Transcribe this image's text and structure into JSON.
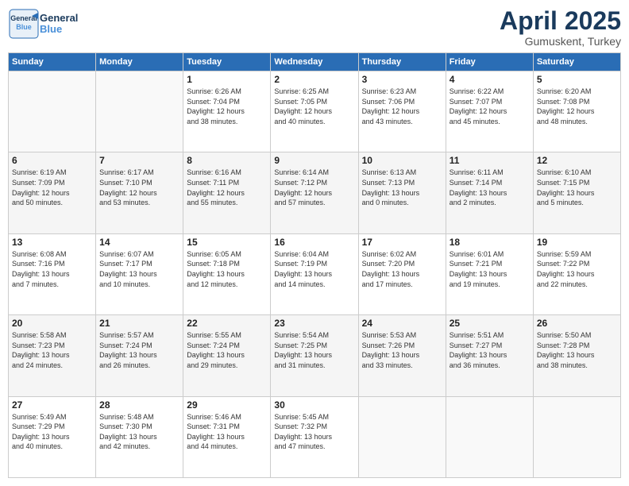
{
  "header": {
    "logo_line1": "General",
    "logo_line2": "Blue",
    "month": "April 2025",
    "location": "Gumuskent, Turkey"
  },
  "days_of_week": [
    "Sunday",
    "Monday",
    "Tuesday",
    "Wednesday",
    "Thursday",
    "Friday",
    "Saturday"
  ],
  "weeks": [
    [
      {
        "day": "",
        "info": ""
      },
      {
        "day": "",
        "info": ""
      },
      {
        "day": "1",
        "info": "Sunrise: 6:26 AM\nSunset: 7:04 PM\nDaylight: 12 hours\nand 38 minutes."
      },
      {
        "day": "2",
        "info": "Sunrise: 6:25 AM\nSunset: 7:05 PM\nDaylight: 12 hours\nand 40 minutes."
      },
      {
        "day": "3",
        "info": "Sunrise: 6:23 AM\nSunset: 7:06 PM\nDaylight: 12 hours\nand 43 minutes."
      },
      {
        "day": "4",
        "info": "Sunrise: 6:22 AM\nSunset: 7:07 PM\nDaylight: 12 hours\nand 45 minutes."
      },
      {
        "day": "5",
        "info": "Sunrise: 6:20 AM\nSunset: 7:08 PM\nDaylight: 12 hours\nand 48 minutes."
      }
    ],
    [
      {
        "day": "6",
        "info": "Sunrise: 6:19 AM\nSunset: 7:09 PM\nDaylight: 12 hours\nand 50 minutes."
      },
      {
        "day": "7",
        "info": "Sunrise: 6:17 AM\nSunset: 7:10 PM\nDaylight: 12 hours\nand 53 minutes."
      },
      {
        "day": "8",
        "info": "Sunrise: 6:16 AM\nSunset: 7:11 PM\nDaylight: 12 hours\nand 55 minutes."
      },
      {
        "day": "9",
        "info": "Sunrise: 6:14 AM\nSunset: 7:12 PM\nDaylight: 12 hours\nand 57 minutes."
      },
      {
        "day": "10",
        "info": "Sunrise: 6:13 AM\nSunset: 7:13 PM\nDaylight: 13 hours\nand 0 minutes."
      },
      {
        "day": "11",
        "info": "Sunrise: 6:11 AM\nSunset: 7:14 PM\nDaylight: 13 hours\nand 2 minutes."
      },
      {
        "day": "12",
        "info": "Sunrise: 6:10 AM\nSunset: 7:15 PM\nDaylight: 13 hours\nand 5 minutes."
      }
    ],
    [
      {
        "day": "13",
        "info": "Sunrise: 6:08 AM\nSunset: 7:16 PM\nDaylight: 13 hours\nand 7 minutes."
      },
      {
        "day": "14",
        "info": "Sunrise: 6:07 AM\nSunset: 7:17 PM\nDaylight: 13 hours\nand 10 minutes."
      },
      {
        "day": "15",
        "info": "Sunrise: 6:05 AM\nSunset: 7:18 PM\nDaylight: 13 hours\nand 12 minutes."
      },
      {
        "day": "16",
        "info": "Sunrise: 6:04 AM\nSunset: 7:19 PM\nDaylight: 13 hours\nand 14 minutes."
      },
      {
        "day": "17",
        "info": "Sunrise: 6:02 AM\nSunset: 7:20 PM\nDaylight: 13 hours\nand 17 minutes."
      },
      {
        "day": "18",
        "info": "Sunrise: 6:01 AM\nSunset: 7:21 PM\nDaylight: 13 hours\nand 19 minutes."
      },
      {
        "day": "19",
        "info": "Sunrise: 5:59 AM\nSunset: 7:22 PM\nDaylight: 13 hours\nand 22 minutes."
      }
    ],
    [
      {
        "day": "20",
        "info": "Sunrise: 5:58 AM\nSunset: 7:23 PM\nDaylight: 13 hours\nand 24 minutes."
      },
      {
        "day": "21",
        "info": "Sunrise: 5:57 AM\nSunset: 7:24 PM\nDaylight: 13 hours\nand 26 minutes."
      },
      {
        "day": "22",
        "info": "Sunrise: 5:55 AM\nSunset: 7:24 PM\nDaylight: 13 hours\nand 29 minutes."
      },
      {
        "day": "23",
        "info": "Sunrise: 5:54 AM\nSunset: 7:25 PM\nDaylight: 13 hours\nand 31 minutes."
      },
      {
        "day": "24",
        "info": "Sunrise: 5:53 AM\nSunset: 7:26 PM\nDaylight: 13 hours\nand 33 minutes."
      },
      {
        "day": "25",
        "info": "Sunrise: 5:51 AM\nSunset: 7:27 PM\nDaylight: 13 hours\nand 36 minutes."
      },
      {
        "day": "26",
        "info": "Sunrise: 5:50 AM\nSunset: 7:28 PM\nDaylight: 13 hours\nand 38 minutes."
      }
    ],
    [
      {
        "day": "27",
        "info": "Sunrise: 5:49 AM\nSunset: 7:29 PM\nDaylight: 13 hours\nand 40 minutes."
      },
      {
        "day": "28",
        "info": "Sunrise: 5:48 AM\nSunset: 7:30 PM\nDaylight: 13 hours\nand 42 minutes."
      },
      {
        "day": "29",
        "info": "Sunrise: 5:46 AM\nSunset: 7:31 PM\nDaylight: 13 hours\nand 44 minutes."
      },
      {
        "day": "30",
        "info": "Sunrise: 5:45 AM\nSunset: 7:32 PM\nDaylight: 13 hours\nand 47 minutes."
      },
      {
        "day": "",
        "info": ""
      },
      {
        "day": "",
        "info": ""
      },
      {
        "day": "",
        "info": ""
      }
    ]
  ]
}
